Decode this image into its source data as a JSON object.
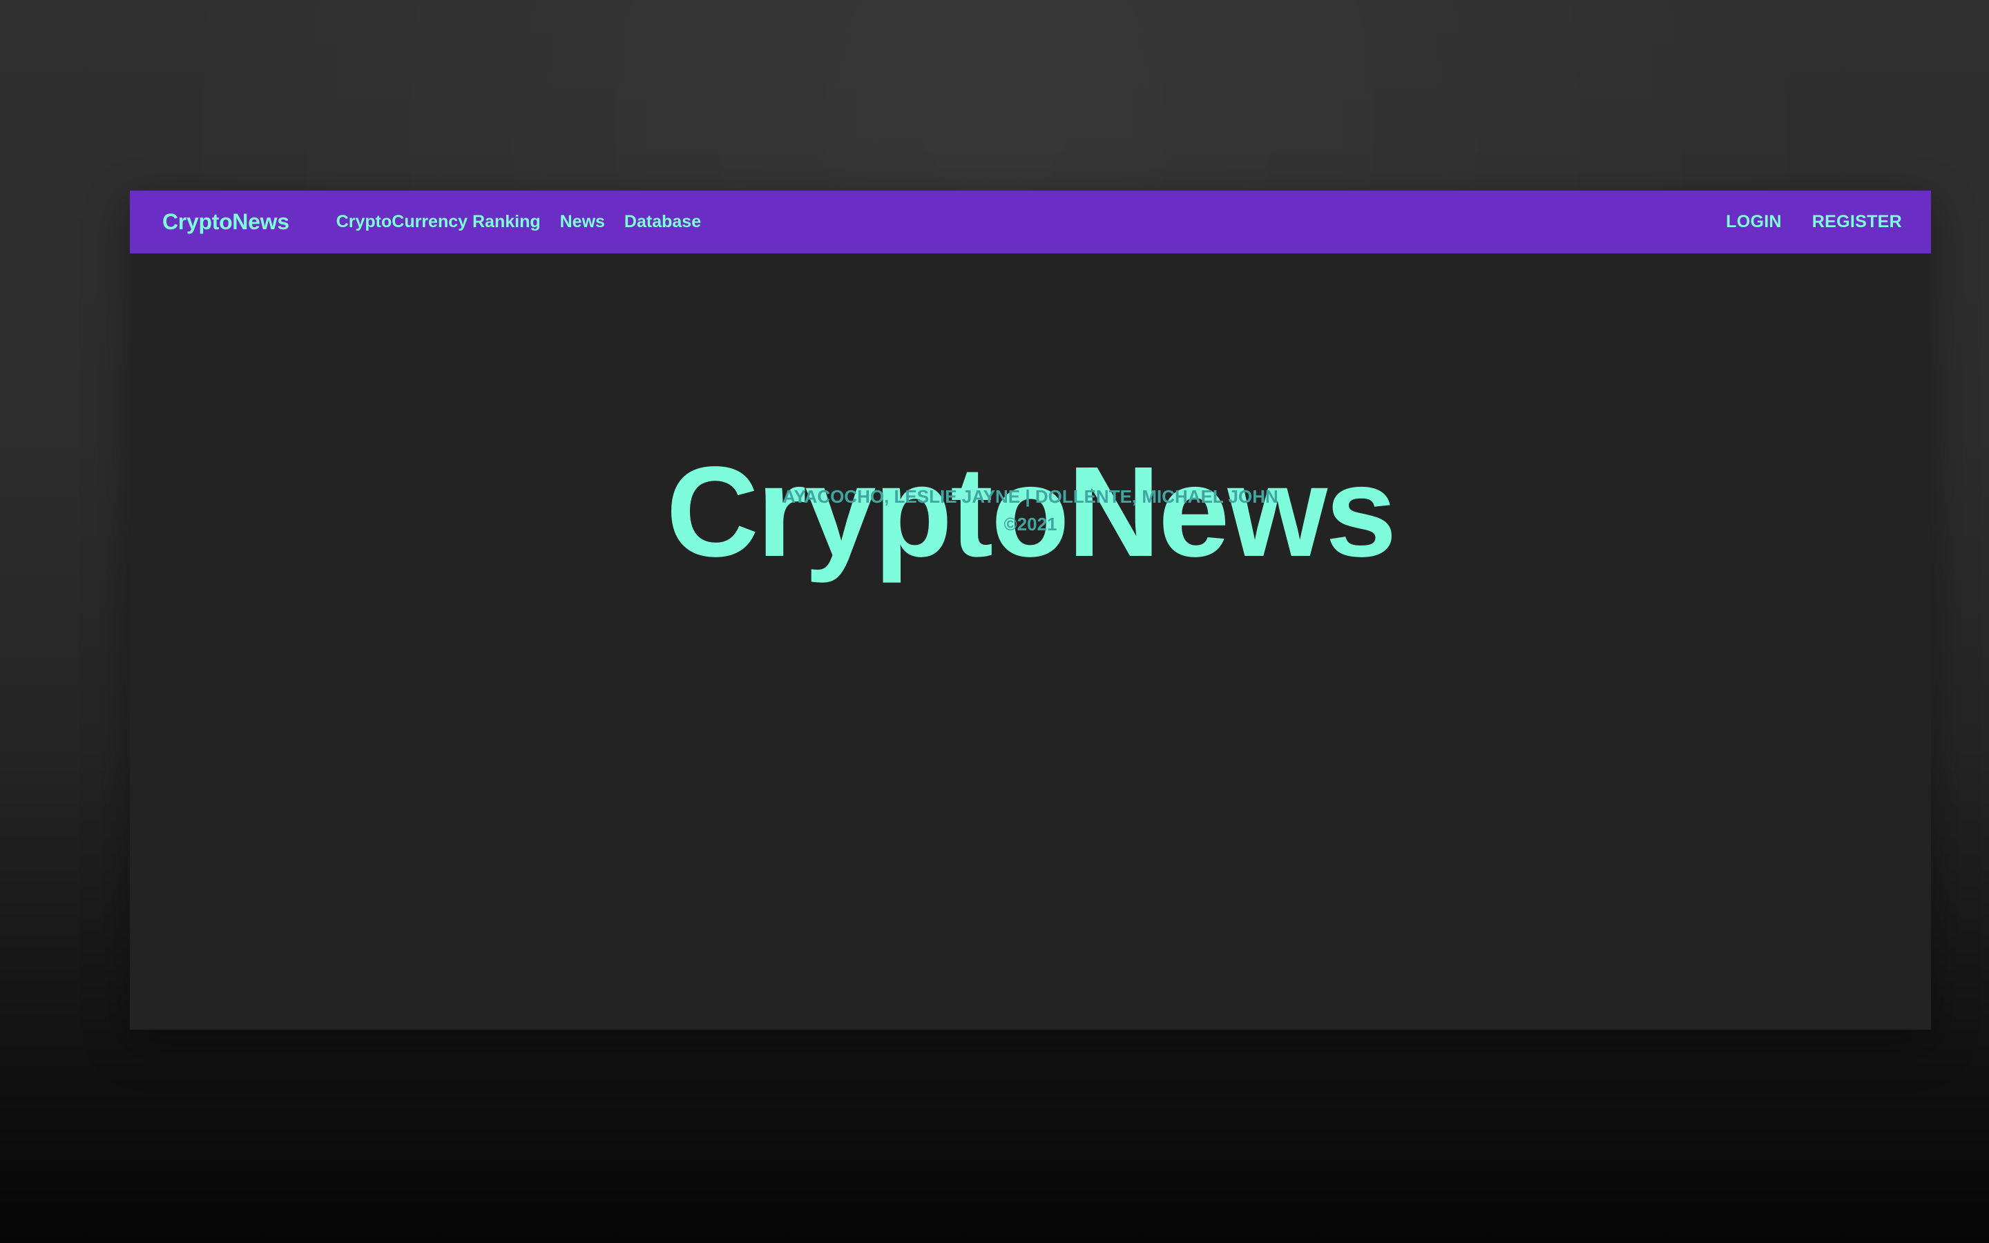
{
  "navbar": {
    "brand": "CryptoNews",
    "links": [
      {
        "label": "CryptoCurrency Ranking"
      },
      {
        "label": "News"
      },
      {
        "label": "Database"
      }
    ],
    "actions": {
      "login": "LOGIN",
      "register": "REGISTER"
    }
  },
  "hero": {
    "title": "CryptoNews",
    "authors": "AYACOCHO, LESLIE JAYNE | DOLLENTE, MICHAEL JOHN",
    "copyright": "©2021"
  },
  "colors": {
    "navbar_bg": "#6a2ec4",
    "accent": "#7ffcdc",
    "subtitle": "#41a5a2",
    "page_bg": "#232323"
  }
}
